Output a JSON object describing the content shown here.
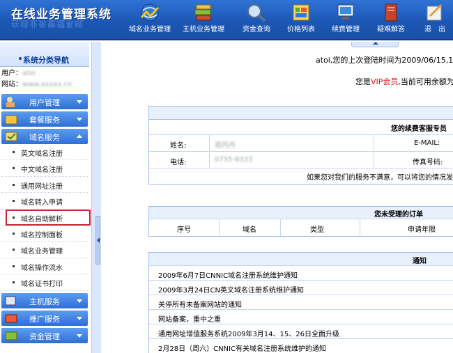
{
  "header": {
    "logo": "在线业务管理系统",
    "logo_reflection": "在线业务管理系统",
    "nav": [
      {
        "label": "域名业务管理",
        "icon": "domain-business-icon"
      },
      {
        "label": "主机业务管理",
        "icon": "host-business-icon"
      },
      {
        "label": "资金查询",
        "icon": "funds-query-icon"
      },
      {
        "label": "价格列表",
        "icon": "price-list-icon"
      },
      {
        "label": "续费管理",
        "icon": "renewal-icon"
      },
      {
        "label": "疑难解答",
        "icon": "help-icon"
      },
      {
        "label": "退　出",
        "icon": "logout-icon"
      }
    ]
  },
  "sidebar": {
    "title": "系统分类导航",
    "user_label": "用户：",
    "user_value": "atoi",
    "site_label": "网站：",
    "site_value": "www.xxxxx.cn",
    "sections": [
      {
        "label": "用户管理",
        "icon": "user-icon",
        "open": false
      },
      {
        "label": "套餐服务",
        "icon": "package-icon",
        "open": false
      },
      {
        "label": "域名服务",
        "icon": "domain-icon",
        "open": true
      },
      {
        "label": "主机服务",
        "icon": "host-icon",
        "open": false
      },
      {
        "label": "推广服务",
        "icon": "promo-icon",
        "open": false
      },
      {
        "label": "资金管理",
        "icon": "funds-icon",
        "open": false
      }
    ],
    "domain_items": [
      "英文域名注册",
      "中文域名注册",
      "通用网址注册",
      "域名转入申请",
      "域名自助解析",
      "域名控制面板",
      "域名业务管理",
      "域名操作流水",
      "域名证书打印"
    ],
    "selected_item": "域名自助解析"
  },
  "main": {
    "welcome": "atoi,您的上次登陆时间为2009/06/15,1",
    "vip_prefix": "您是",
    "vip_text": "VIP会员",
    "vip_suffix": ",当前可用余额为",
    "contact": {
      "title": "您的续费客服专员",
      "name_label": "姓名:",
      "name_value": "郑丹丹",
      "email_label": "E-MAIL:",
      "phone_label": "电话:",
      "phone_value": "0755-8333",
      "fax_label": "传真号码:",
      "note": "如果您对我们的服务不满意，可以将您的情况发"
    },
    "orders": {
      "title": "您未受理的订单",
      "columns": [
        "序号",
        "域名",
        "类型",
        "申请年限"
      ]
    },
    "notices": {
      "title": "通知",
      "items": [
        "2009年6月7日CNNIC域名注册系统维护通知",
        "2009年3月24日CN英文域名注册系统维护通知",
        "关停所有未备案网站的通知",
        "网站备案，重中之重",
        "通用网址增值服务系统2009年3月14、15、26日全面升级",
        "2月28日（周六）CNNIC有关域名注册系统维护的通知"
      ]
    }
  }
}
